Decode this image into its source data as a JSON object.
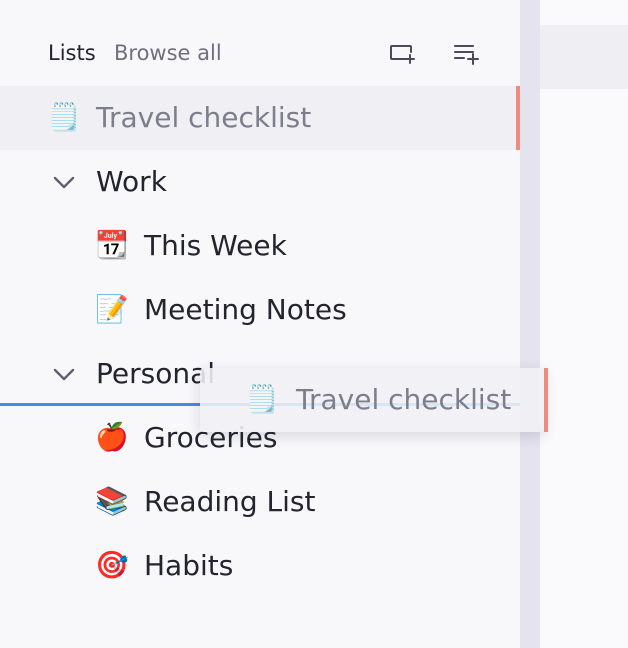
{
  "header": {
    "title": "Lists",
    "browse_link": "Browse all",
    "new_list_icon": "add-window-icon",
    "new_item_icon": "add-list-icon"
  },
  "items": [
    {
      "emoji": "🗒️",
      "label": "Travel checklist",
      "selected": true
    },
    {
      "label": "Work",
      "group": true,
      "expanded": true
    },
    {
      "emoji": "📆",
      "label": "This Week"
    },
    {
      "emoji": "📝",
      "label": "Meeting Notes"
    },
    {
      "label": "Personal",
      "group": true,
      "expanded": true
    },
    {
      "emoji": "🍎",
      "label": "Groceries"
    },
    {
      "emoji": "📚",
      "label": "Reading List"
    },
    {
      "emoji": "🎯",
      "label": "Habits"
    }
  ],
  "drag_preview": {
    "emoji": "🗒️",
    "label": "Travel checklist"
  },
  "colors": {
    "accent": "#ef8a7e",
    "drop_indicator": "#3a8ee6",
    "selected_bg": "#efeff4"
  }
}
